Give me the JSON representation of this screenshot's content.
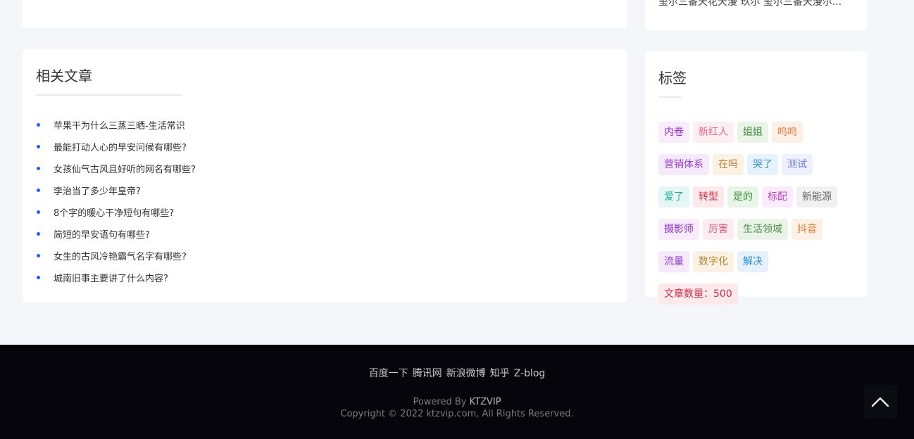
{
  "top_right": {
    "partial_text": "玺尔三番天花天漫   玖尔 玺尔三番天漫尔..."
  },
  "related": {
    "title": "相关文章",
    "items": [
      "苹果干为什么三蒸三晒-生活常识",
      "最能打动人心的早安问候有哪些?",
      "女孩仙气古风且好听的网名有哪些?",
      "李治当了多少年皇帝?",
      "8个字的暖心干净短句有哪些?",
      "简短的早安语句有哪些?",
      "女生的古风冷艳霸气名字有哪些?",
      "城南旧事主要讲了什么内容?"
    ],
    "bullet_color": "#1e60ff"
  },
  "tags": {
    "title": "标签",
    "items": [
      {
        "label": "内卷",
        "color": "#9b2cc8",
        "bg": "#f8ecfd"
      },
      {
        "label": "新红人",
        "color": "#e06a8a",
        "bg": "#fdeef2"
      },
      {
        "label": "姐姐",
        "color": "#3f8a3f",
        "bg": "#e9f4e6"
      },
      {
        "label": "呜呜",
        "color": "#e8763a",
        "bg": "#fdf0e6"
      },
      {
        "label": "营销体系",
        "color": "#9b40d0",
        "bg": "#f5eafb"
      },
      {
        "label": "在吗",
        "color": "#b8863a",
        "bg": "#fbf2e3"
      },
      {
        "label": "哭了",
        "color": "#2f8fd8",
        "bg": "#e6f3fd"
      },
      {
        "label": "测试",
        "color": "#6a7ee0",
        "bg": "#eef1fd"
      },
      {
        "label": "爱了",
        "color": "#25a89a",
        "bg": "#e4f7f4"
      },
      {
        "label": "转型",
        "color": "#d0304a",
        "bg": "#fde9ec"
      },
      {
        "label": "是的",
        "color": "#3a9040",
        "bg": "#e8f5e7"
      },
      {
        "label": "标配",
        "color": "#c040c8",
        "bg": "#fbebfc"
      },
      {
        "label": "新能源",
        "color": "#666666",
        "bg": "#f1f1f1"
      },
      {
        "label": "摄影师",
        "color": "#8a30b8",
        "bg": "#f7ebfc"
      },
      {
        "label": "厉害",
        "color": "#e05a7a",
        "bg": "#fdecf0"
      },
      {
        "label": "生活领域",
        "color": "#4a8a4a",
        "bg": "#e9f3e6"
      },
      {
        "label": "抖音",
        "color": "#e87a30",
        "bg": "#fdf0e4"
      },
      {
        "label": "流量",
        "color": "#9040d0",
        "bg": "#f4eafc"
      },
      {
        "label": "数字化",
        "color": "#b8863a",
        "bg": "#fbf2e3"
      },
      {
        "label": "解决",
        "color": "#3090d8",
        "bg": "#e5f2fd"
      },
      {
        "label": "文章数量：500",
        "color": "#c8304a",
        "bg": "#fde8ec"
      }
    ]
  },
  "footer": {
    "links": [
      "百度一下",
      "腾讯网",
      "新浪微博",
      "知乎",
      "Z-blog"
    ],
    "powered_prefix": "Powered By ",
    "powered_brand": "KTZVIP",
    "copyright": "Copyright © 2022 ktzvip.com, All Rights Reserved."
  },
  "back_to_top": {
    "icon": "chevron-up-icon"
  }
}
